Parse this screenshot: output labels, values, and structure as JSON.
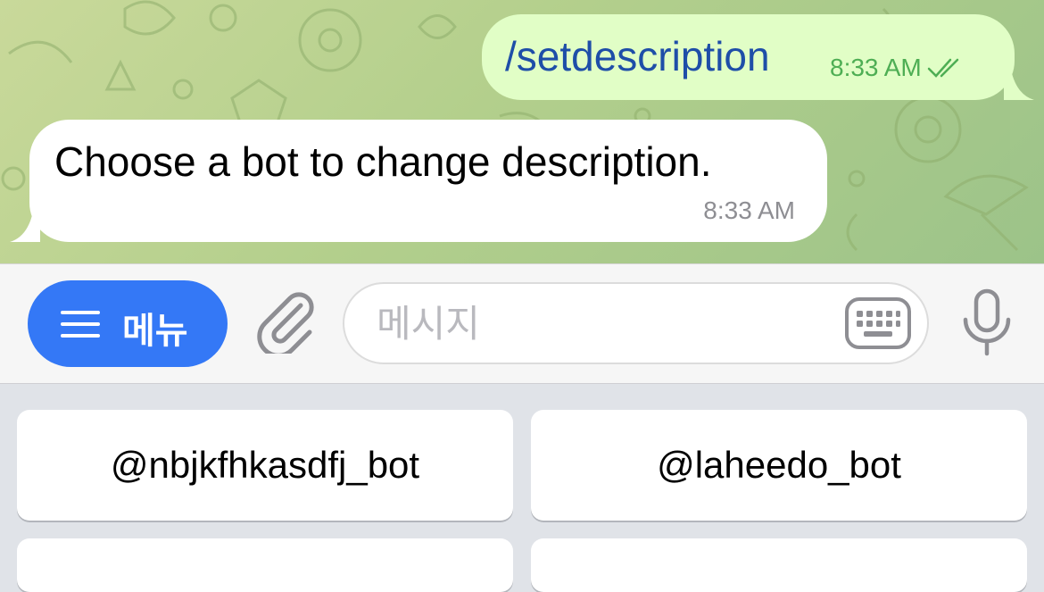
{
  "chat": {
    "outgoing": {
      "text": "/setdescription",
      "time": "8:33 AM",
      "status_icon": "double-check-icon"
    },
    "incoming": {
      "text": "Choose a bot to change description.",
      "time": "8:33 AM"
    }
  },
  "input_bar": {
    "menu_label": "메뉴",
    "placeholder": "메시지",
    "value": ""
  },
  "keyboard": {
    "buttons": [
      {
        "label": "@nbjkfhkasdfj_bot"
      },
      {
        "label": "@laheedo_bot"
      },
      {
        "label": ""
      },
      {
        "label": ""
      }
    ]
  },
  "colors": {
    "accent": "#3478f6",
    "outgoing_bubble": "#e1fec6",
    "outgoing_text": "#1e4ea8",
    "outgoing_meta": "#4eae54",
    "incoming_bubble": "#ffffff",
    "wallpaper": "#b3cf8c"
  }
}
